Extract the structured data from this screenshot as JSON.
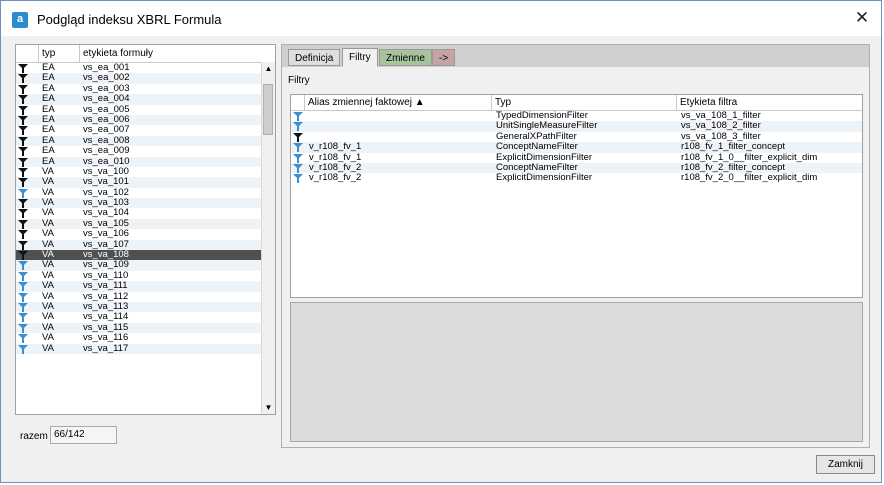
{
  "window": {
    "title": "Podgląd indeksu XBRL Formula",
    "icon_letter": "a",
    "close_glyph": "✕"
  },
  "list": {
    "columns": [
      "typ",
      "etykieta formuły"
    ],
    "rows": [
      {
        "icon": "black",
        "typ": "EA",
        "label": "vs_ea_001"
      },
      {
        "icon": "black",
        "typ": "EA",
        "label": "vs_ea_002"
      },
      {
        "icon": "black",
        "typ": "EA",
        "label": "vs_ea_003"
      },
      {
        "icon": "black",
        "typ": "EA",
        "label": "vs_ea_004"
      },
      {
        "icon": "black",
        "typ": "EA",
        "label": "vs_ea_005"
      },
      {
        "icon": "black",
        "typ": "EA",
        "label": "vs_ea_006"
      },
      {
        "icon": "black",
        "typ": "EA",
        "label": "vs_ea_007"
      },
      {
        "icon": "black",
        "typ": "EA",
        "label": "vs_ea_008"
      },
      {
        "icon": "black",
        "typ": "EA",
        "label": "vs_ea_009"
      },
      {
        "icon": "black",
        "typ": "EA",
        "label": "vs_ea_010"
      },
      {
        "icon": "black",
        "typ": "VA",
        "label": "vs_va_100"
      },
      {
        "icon": "black",
        "typ": "VA",
        "label": "vs_va_101"
      },
      {
        "icon": "blue",
        "typ": "VA",
        "label": "vs_va_102"
      },
      {
        "icon": "black",
        "typ": "VA",
        "label": "vs_va_103"
      },
      {
        "icon": "black",
        "typ": "VA",
        "label": "vs_va_104"
      },
      {
        "icon": "black",
        "typ": "VA",
        "label": "vs_va_105"
      },
      {
        "icon": "black",
        "typ": "VA",
        "label": "vs_va_106"
      },
      {
        "icon": "black",
        "typ": "VA",
        "label": "vs_va_107"
      },
      {
        "icon": "black",
        "typ": "VA",
        "label": "vs_va_108",
        "selected": true
      },
      {
        "icon": "blue",
        "typ": "VA",
        "label": "vs_va_109"
      },
      {
        "icon": "blue",
        "typ": "VA",
        "label": "vs_va_110"
      },
      {
        "icon": "blue",
        "typ": "VA",
        "label": "vs_va_111"
      },
      {
        "icon": "blue",
        "typ": "VA",
        "label": "vs_va_112"
      },
      {
        "icon": "blue",
        "typ": "VA",
        "label": "vs_va_113"
      },
      {
        "icon": "blue",
        "typ": "VA",
        "label": "vs_va_114"
      },
      {
        "icon": "blue",
        "typ": "VA",
        "label": "vs_va_115"
      },
      {
        "icon": "blue",
        "typ": "VA",
        "label": "vs_va_116"
      },
      {
        "icon": "blue",
        "typ": "VA",
        "label": "vs_va_117"
      }
    ],
    "scroll_up": "▲",
    "scroll_down": "▼"
  },
  "total": {
    "label": "razem",
    "value": "66/142"
  },
  "tabs": [
    {
      "label": "Definicja",
      "style": "normal"
    },
    {
      "label": "Filtry",
      "style": "active"
    },
    {
      "label": "Zmienne",
      "style": "green"
    },
    {
      "label": "->",
      "style": "arrow"
    }
  ],
  "filters": {
    "section_label": "Filtry",
    "columns": [
      "Alias zmiennej faktowej ▲",
      "Typ",
      "Etykieta filtra"
    ],
    "rows": [
      {
        "icon": "blue",
        "alias": "",
        "type": "TypedDimensionFilter",
        "label": "vs_va_108_1_filter"
      },
      {
        "icon": "blue",
        "alias": "",
        "type": "UnitSingleMeasureFilter",
        "label": "vs_va_108_2_filter"
      },
      {
        "icon": "black",
        "alias": "",
        "type": "GeneralXPathFilter",
        "label": "vs_va_108_3_filter"
      },
      {
        "icon": "blue",
        "alias": "v_r108_fv_1",
        "type": "ConceptNameFilter",
        "label": "r108_fv_1_filter_concept"
      },
      {
        "icon": "blue",
        "alias": "v_r108_fv_1",
        "type": "ExplicitDimensionFilter",
        "label": "r108_fv_1_0__filter_explicit_dim"
      },
      {
        "icon": "blue",
        "alias": "v_r108_fv_2",
        "type": "ConceptNameFilter",
        "label": "r108_fv_2_filter_concept"
      },
      {
        "icon": "blue",
        "alias": "v_r108_fv_2",
        "type": "ExplicitDimensionFilter",
        "label": "r108_fv_2_0__filter_explicit_dim"
      }
    ]
  },
  "buttons": {
    "close": "Zamknij"
  },
  "colors": {
    "filter_black": "#111111",
    "filter_blue": "#3a8fd1",
    "selected_row": "#505050"
  }
}
